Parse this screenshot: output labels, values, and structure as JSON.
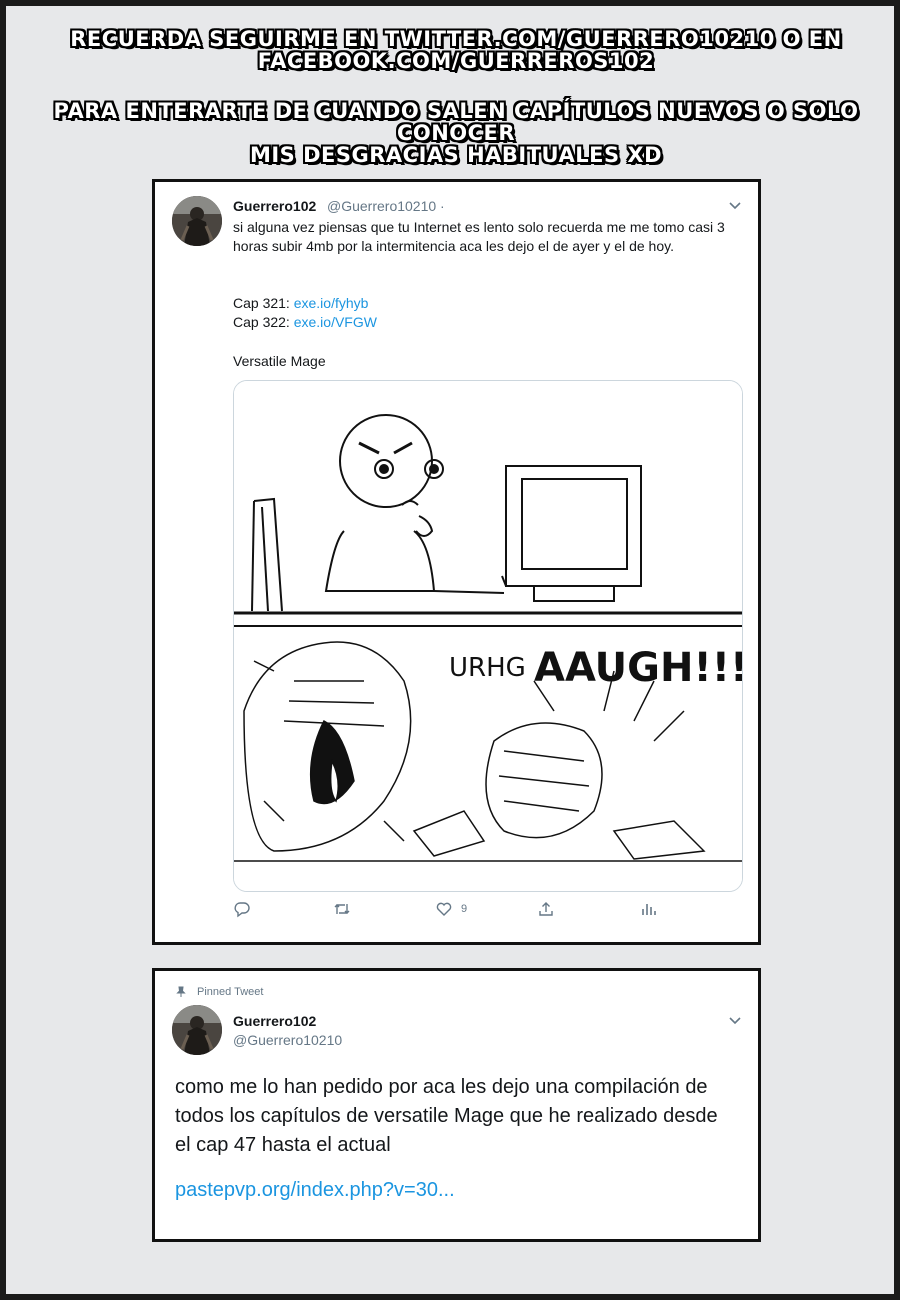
{
  "banner": {
    "line1": "RECUERDA SEGUIRME EN TWITTER.COM/GUERRERO10210 O EN",
    "line2": "FACEBOOK.COM/GUERREROS102",
    "line3": "PARA ENTERARTE DE CUANDO SALEN CAPÍTULOS NUEVOS O SOLO CONOCER",
    "line4": "MIS DESGRACIAS HABITUALES XD"
  },
  "tweet1": {
    "name": "Guerrero102",
    "handle": "@Guerrero10210 ·",
    "text": "si alguna vez piensas que tu Internet es lento solo recuerda me me tomo casi 3 horas subir 4mb por la intermitencia aca les dejo el de ayer y el de hoy.",
    "cap1_label": "Cap 321: ",
    "cap1_link": "exe.io/fyhyb",
    "cap2_label": "Cap 322: ",
    "cap2_link": "exe.io/VFGW",
    "series": "Versatile Mage",
    "image_text": "URHG",
    "image_text2": "AAUGH!!!",
    "actions": {
      "reply_icon": "reply-icon",
      "retweet_icon": "retweet-icon",
      "like_icon": "heart-icon",
      "like_count": "9",
      "share_icon": "share-icon",
      "analytics_icon": "analytics-icon"
    }
  },
  "tweet2": {
    "pinned_label": "Pinned Tweet",
    "name": "Guerrero102",
    "handle": "@Guerrero10210",
    "text": "como me lo han pedido por aca les dejo una compilación de todos los capítulos de versatile Mage que he realizado desde el cap 47 hasta el actual",
    "link": "pastepvp.org/index.php?v=30..."
  },
  "colors": {
    "link": "#1b95e0",
    "muted": "#657786",
    "page_bg": "#e7e8ea"
  }
}
